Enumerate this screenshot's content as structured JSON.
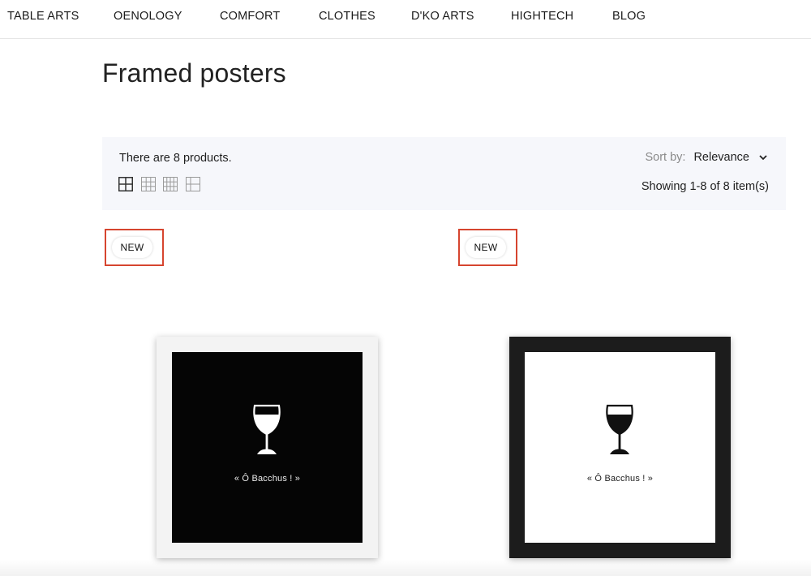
{
  "nav": {
    "items": [
      "TABLE ARTS",
      "OENOLOGY",
      "COMFORT",
      "CLOTHES",
      "D'KO ARTS",
      "HIGHTECH",
      "BLOG"
    ]
  },
  "page": {
    "title": "Framed posters"
  },
  "toolbar": {
    "product_count": "There are 8 products.",
    "sort_label": "Sort by:",
    "sort_value": "Relevance",
    "showing": "Showing 1-8 of 8 item(s)",
    "view_icons": [
      "grid-2-icon",
      "grid-3-icon",
      "grid-4-icon",
      "list-icon"
    ]
  },
  "products": [
    {
      "badge": "NEW",
      "caption": "« Ô Bacchus ! »",
      "style": "black-art-white-frame"
    },
    {
      "badge": "NEW",
      "caption": "« Ô Bacchus ! »",
      "style": "white-art-black-frame"
    }
  ],
  "colors": {
    "highlight": "#d6452f",
    "toolbar_bg": "#f6f7fb"
  }
}
